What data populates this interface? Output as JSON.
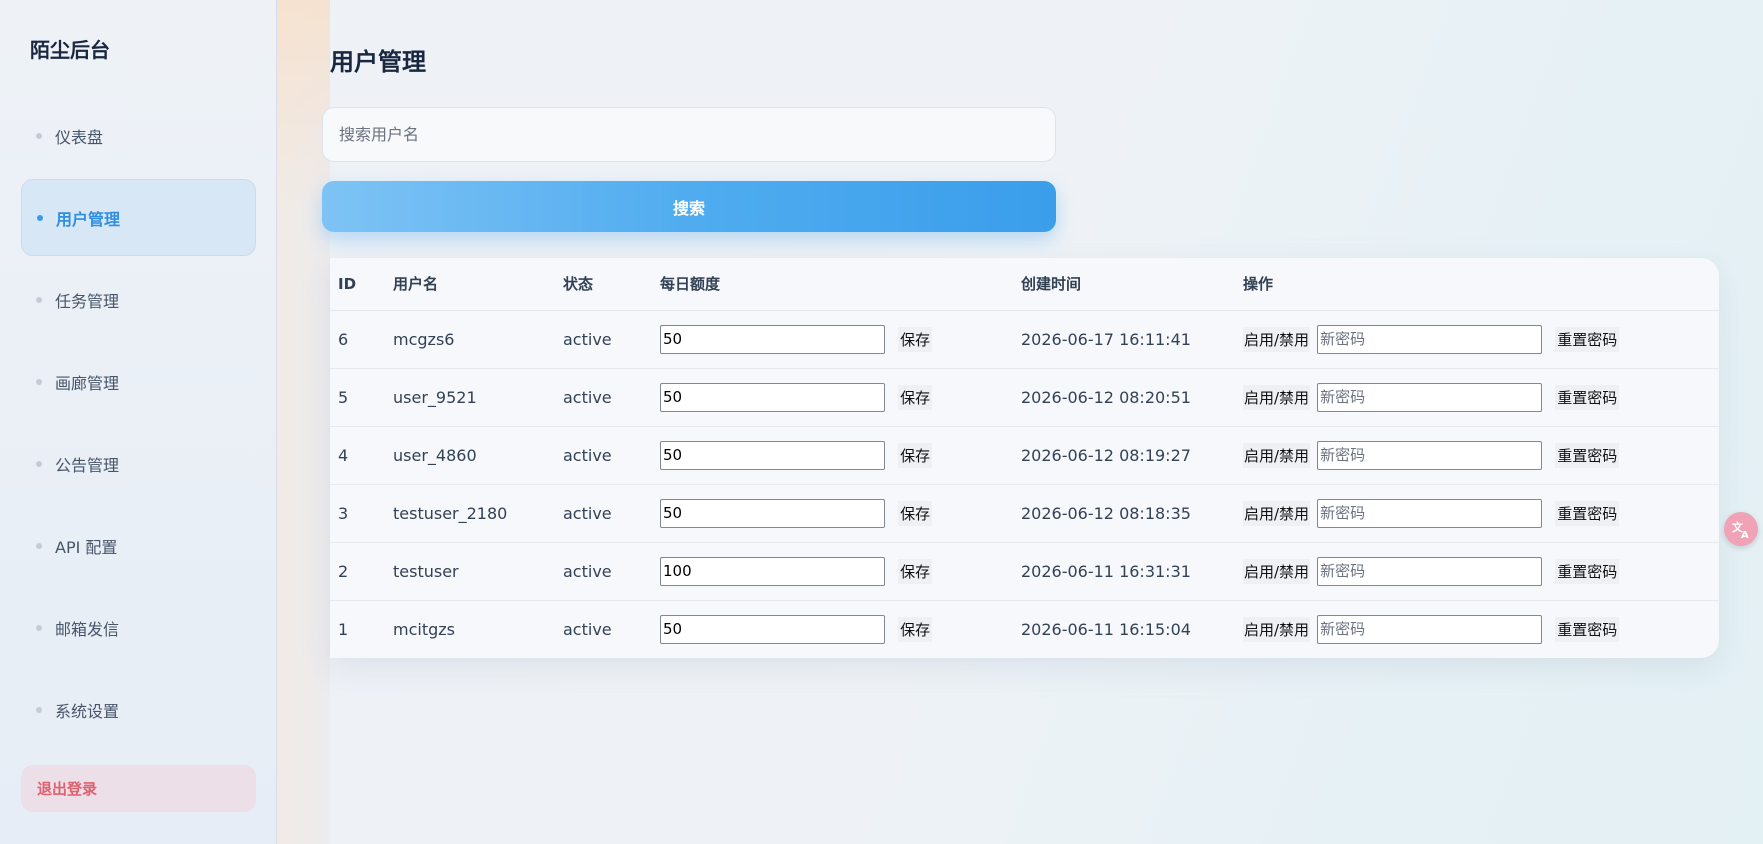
{
  "sidebar": {
    "brand": "陌尘后台",
    "items": [
      {
        "label": "仪表盘",
        "active": false
      },
      {
        "label": "用户管理",
        "active": true
      },
      {
        "label": "任务管理",
        "active": false
      },
      {
        "label": "画廊管理",
        "active": false
      },
      {
        "label": "公告管理",
        "active": false
      },
      {
        "label": "API 配置",
        "active": false
      },
      {
        "label": "邮箱发信",
        "active": false
      },
      {
        "label": "系统设置",
        "active": false
      }
    ],
    "logout_label": "退出登录"
  },
  "main": {
    "title": "用户管理",
    "search": {
      "placeholder": "搜索用户名",
      "value": ""
    },
    "search_button": "搜索",
    "table": {
      "headers": {
        "id": "ID",
        "username": "用户名",
        "status": "状态",
        "quota": "每日额度",
        "created": "创建时间",
        "actions": "操作"
      },
      "rows": [
        {
          "id": "6",
          "username": "mcgzs6",
          "status": "active",
          "quota": "50",
          "created": "2026-06-17 16:11:41"
        },
        {
          "id": "5",
          "username": "user_9521",
          "status": "active",
          "quota": "50",
          "created": "2026-06-12 08:20:51"
        },
        {
          "id": "4",
          "username": "user_4860",
          "status": "active",
          "quota": "50",
          "created": "2026-06-12 08:19:27"
        },
        {
          "id": "3",
          "username": "testuser_2180",
          "status": "active",
          "quota": "50",
          "created": "2026-06-12 08:18:35"
        },
        {
          "id": "2",
          "username": "testuser",
          "status": "active",
          "quota": "100",
          "created": "2026-06-11 16:31:31"
        },
        {
          "id": "1",
          "username": "mcitgzs",
          "status": "active",
          "quota": "50",
          "created": "2026-06-11 16:15:04"
        }
      ],
      "save_label": "保存",
      "toggle_label": "启用/禁用",
      "password_placeholder": "新密码",
      "reset_label": "重置密码"
    }
  },
  "colors": {
    "accent": "#3a9eeb",
    "logout": "#e0606e",
    "translate_badge": "#f0a3b6"
  },
  "icons": {
    "translate": "translate-icon"
  }
}
